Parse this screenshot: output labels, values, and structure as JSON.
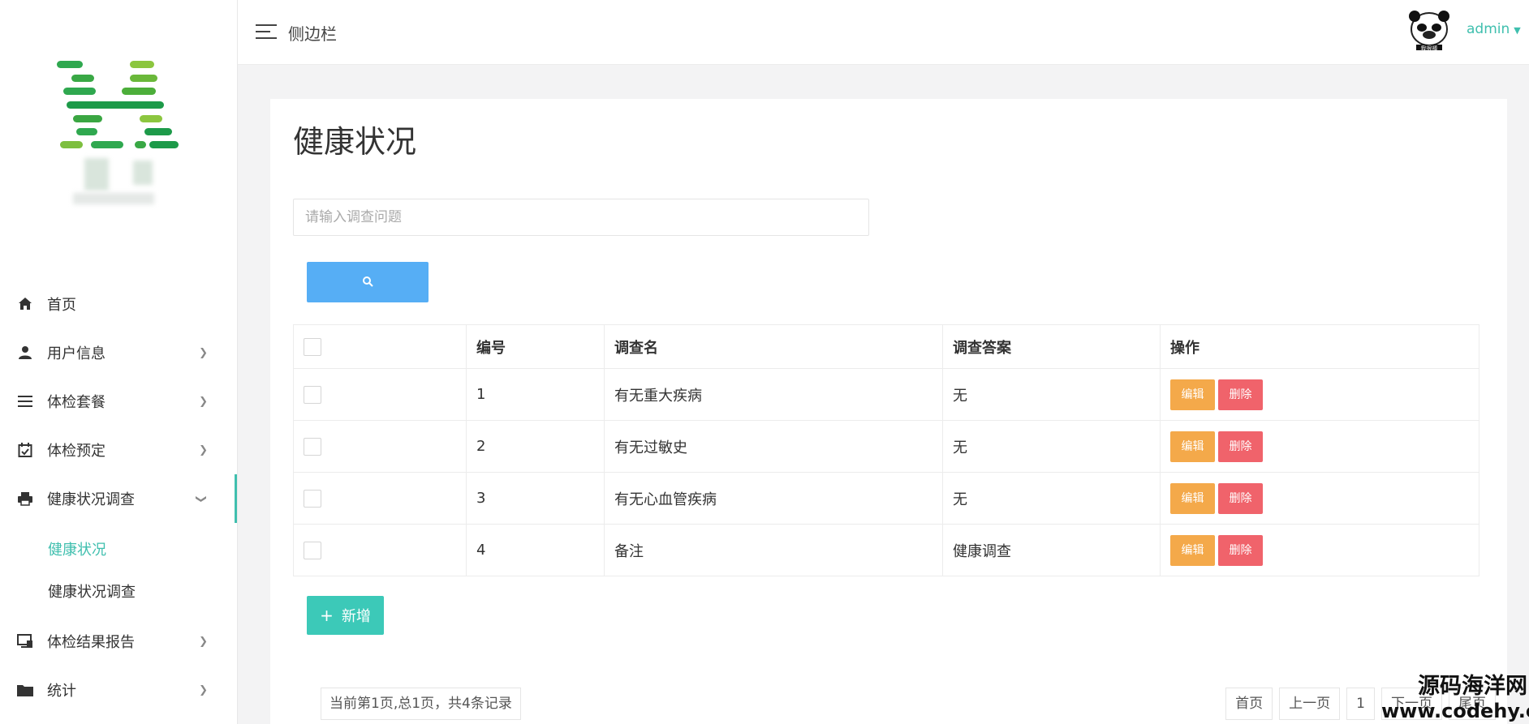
{
  "topbar": {
    "title": "侧边栏",
    "user": "admin",
    "avatar_caption": "我很棒"
  },
  "sidebar": {
    "items": [
      {
        "label": "首页",
        "icon": "home-icon",
        "has_arrow": false
      },
      {
        "label": "用户信息",
        "icon": "user-icon",
        "has_arrow": true
      },
      {
        "label": "体检套餐",
        "icon": "list-icon",
        "has_arrow": true
      },
      {
        "label": "体检预定",
        "icon": "calendar-check-icon",
        "has_arrow": true
      },
      {
        "label": "健康状况调查",
        "icon": "printer-icon",
        "has_arrow": true,
        "expanded": true
      },
      {
        "label": "体检结果报告",
        "icon": "monitor-icon",
        "has_arrow": true
      },
      {
        "label": "统计",
        "icon": "folder-icon",
        "has_arrow": true
      }
    ],
    "subitems": [
      {
        "label": "健康状况",
        "active": true
      },
      {
        "label": "健康状况调查",
        "active": false
      }
    ]
  },
  "main": {
    "title": "健康状况",
    "search_placeholder": "请输入调查问题",
    "table": {
      "headers": [
        "编号",
        "调查名",
        "调查答案",
        "操作"
      ],
      "rows": [
        {
          "id": "1",
          "name": "有无重大疾病",
          "answer": "无"
        },
        {
          "id": "2",
          "name": "有无过敏史",
          "answer": "无"
        },
        {
          "id": "3",
          "name": "有无心血管疾病",
          "answer": "无"
        },
        {
          "id": "4",
          "name": "备注",
          "answer": "健康调查"
        }
      ],
      "edit_label": "编辑",
      "delete_label": "删除"
    },
    "add_label": "新增",
    "pager": {
      "info": "当前第1页,总1页，共4条记录",
      "first": "首页",
      "prev": "上一页",
      "current": "1",
      "next": "下一页",
      "last": "尾页"
    }
  },
  "watermark": {
    "line1": "源码海洋网",
    "line2": "www.codehy.com"
  },
  "colors": {
    "accent": "#3fbfae",
    "search_button": "#56aef5",
    "edit_button": "#f4a94a",
    "delete_button": "#f0636b",
    "add_button": "#3cc9b8"
  }
}
